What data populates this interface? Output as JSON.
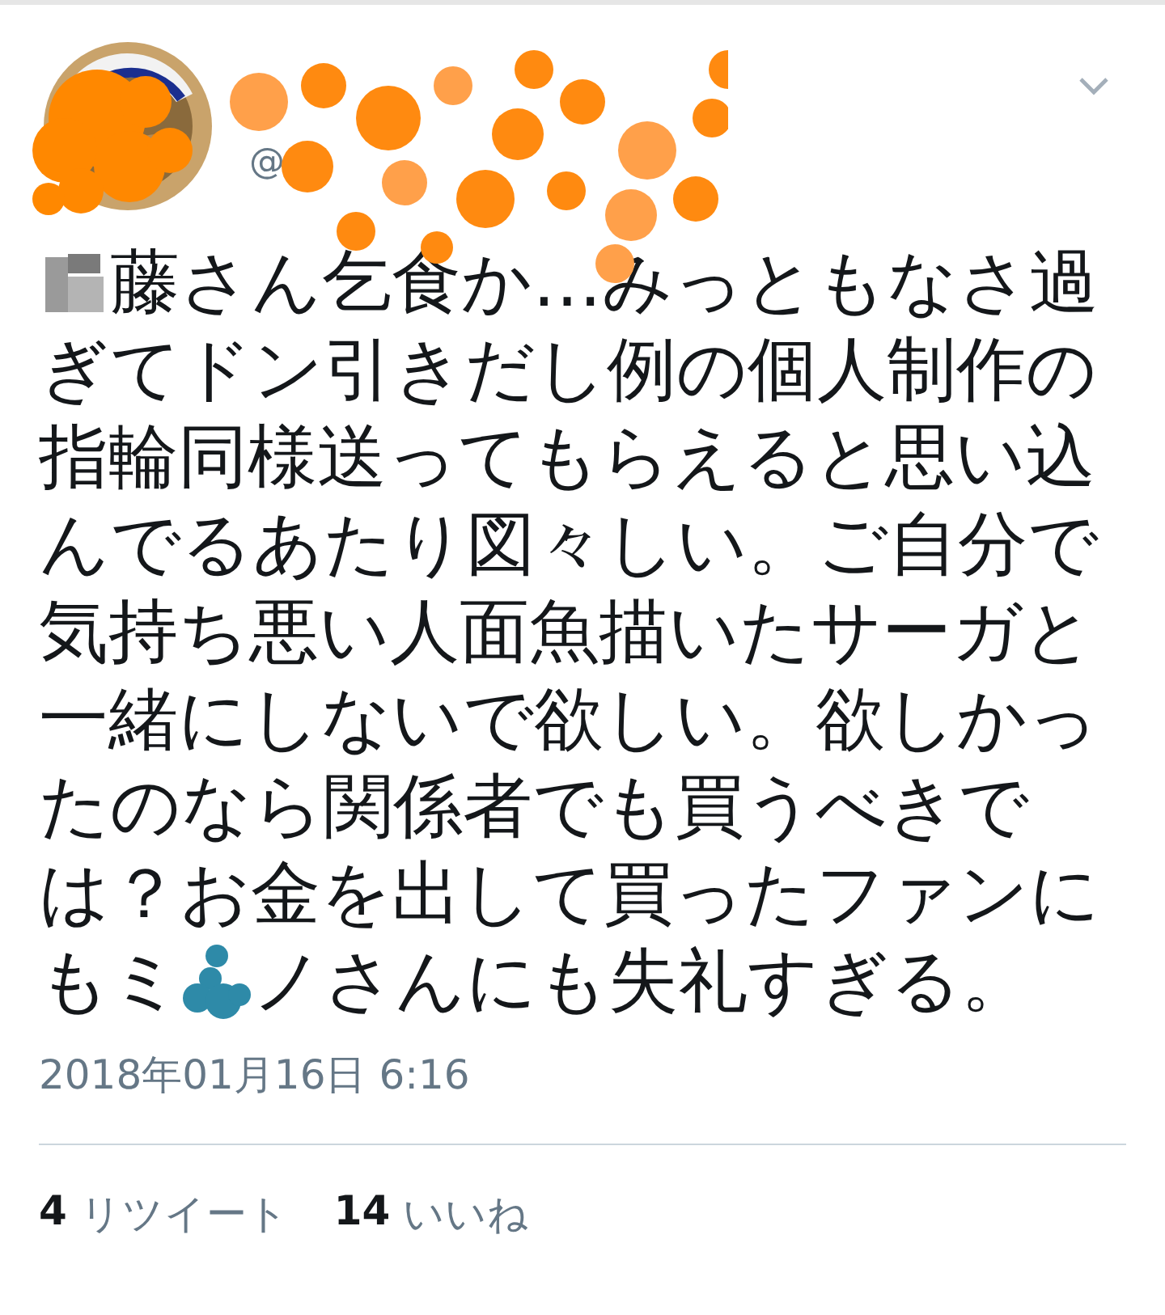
{
  "tweet": {
    "author": {
      "handle": "@"
    },
    "lines": [
      [
        {
          "kind": "blur-redaction"
        },
        {
          "kind": "text",
          "text": "藤さん乞食か…みっともなさ過"
        }
      ],
      [
        {
          "kind": "text",
          "text": "ぎてドン引きだし例の個人制作の"
        }
      ],
      [
        {
          "kind": "text",
          "text": "指輪同様送ってもらえると思い込"
        }
      ],
      [
        {
          "kind": "text",
          "text": "んでるあたり図々しい。ご自分で"
        }
      ],
      [
        {
          "kind": "text",
          "text": "気持ち悪い人面魚描いたサーガと"
        }
      ],
      [
        {
          "kind": "text",
          "text": "一緒にしないで欲しい。欲しかっ"
        }
      ],
      [
        {
          "kind": "text",
          "text": "たのなら関係者でも買うべきで"
        }
      ],
      [
        {
          "kind": "text",
          "text": "は？お金を出して買ったファンに"
        }
      ],
      [
        {
          "kind": "text",
          "text": "もミ"
        },
        {
          "kind": "dot-redaction"
        },
        {
          "kind": "text",
          "text": "ノさんにも失礼すぎる。"
        }
      ]
    ],
    "timestamp": "2018年01月16日 6:16",
    "stats": [
      {
        "count": "4",
        "label": "リツイート"
      },
      {
        "count": "14",
        "label": "いいね"
      }
    ]
  }
}
